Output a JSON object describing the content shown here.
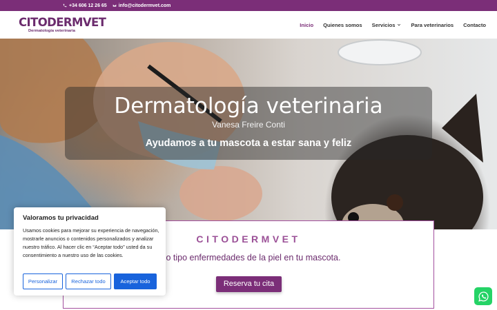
{
  "topbar": {
    "phone": "+34 606 12 26 65",
    "email": "info@citodermvet.com"
  },
  "header": {
    "logo_word": "CITODERMVET",
    "logo_subtitle": "Dermatología  veterinaria",
    "nav": [
      {
        "label": "Inicio",
        "active": true
      },
      {
        "label": "Quienes somos"
      },
      {
        "label": "Servicios",
        "has_dropdown": true
      },
      {
        "label": "Para veterinarios"
      },
      {
        "label": "Contacto"
      }
    ]
  },
  "hero": {
    "title": "Dermatología veterinaria",
    "subtitle": "Vanesa Freire Conti",
    "tagline": "Ayudamos a tu mascota a estar sana y feliz"
  },
  "card": {
    "title": "CITODERMVET",
    "text": "odo tipo enfermedades de la piel en tu mascota.",
    "button": "Reserva tu cita"
  },
  "cookie": {
    "title": "Valoramos tu privacidad",
    "text": "Usamos cookies para mejorar su experiencia de navegación, mostrarle anuncios o contenidos personalizados y analizar nuestro tráfico. Al hacer clic en “Aceptar todo” usted da su consentimiento a nuestro uso de las cookies.",
    "buttons": {
      "customize": "Personalizar",
      "reject": "Rechazar todo",
      "accept": "Aceptar todo"
    }
  },
  "colors": {
    "brand": "#7b2e78",
    "cookie_blue": "#1863dc",
    "whatsapp": "#25d366"
  },
  "icons": [
    "phone-icon",
    "email-icon",
    "chevron-down-icon",
    "whatsapp-icon"
  ]
}
